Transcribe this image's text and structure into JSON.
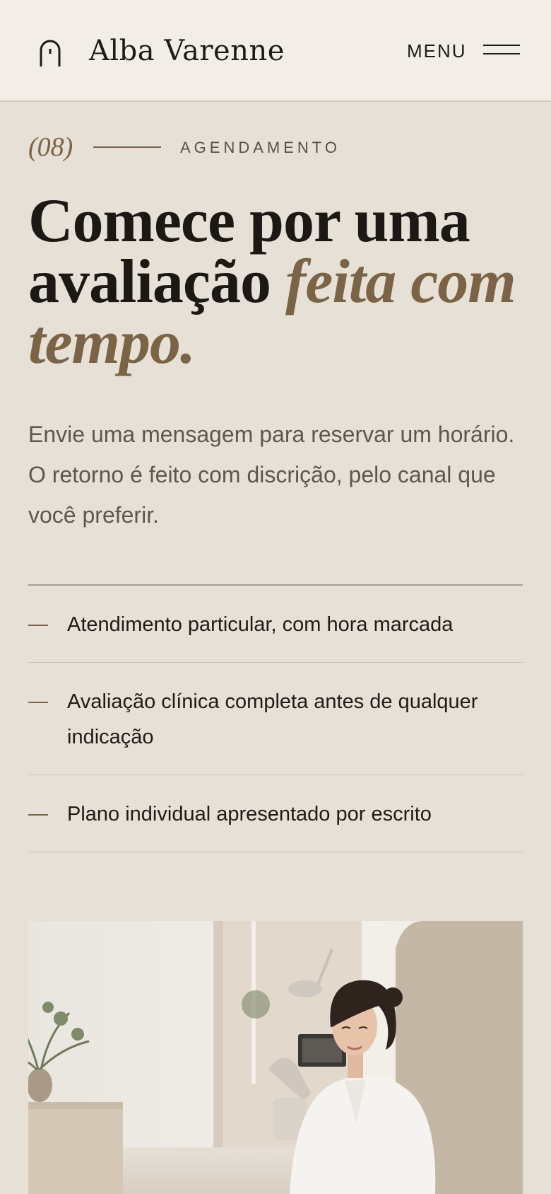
{
  "header": {
    "brand": "Alba Varenne",
    "menu_label": "MENU"
  },
  "section": {
    "number": "(08)",
    "label": "AGENDAMENTO"
  },
  "headline": {
    "part1": "Comece por uma avaliação ",
    "part2": "feita com tempo."
  },
  "intro": "Envie uma mensagem para reservar um horário. O retorno é feito com discrição, pelo canal que você preferir.",
  "features": [
    "Atendimento particular, com hora marcada",
    "Avaliação clínica completa antes de qualquer indicação",
    "Plano individual apresentado por escrito"
  ],
  "colors": {
    "accent": "#7a6445",
    "background": "#e7e0d6",
    "header_background": "#f2ede7",
    "text": "#1f1b17"
  },
  "icons": [
    "arch-logo-icon",
    "hamburger-menu-icon"
  ]
}
